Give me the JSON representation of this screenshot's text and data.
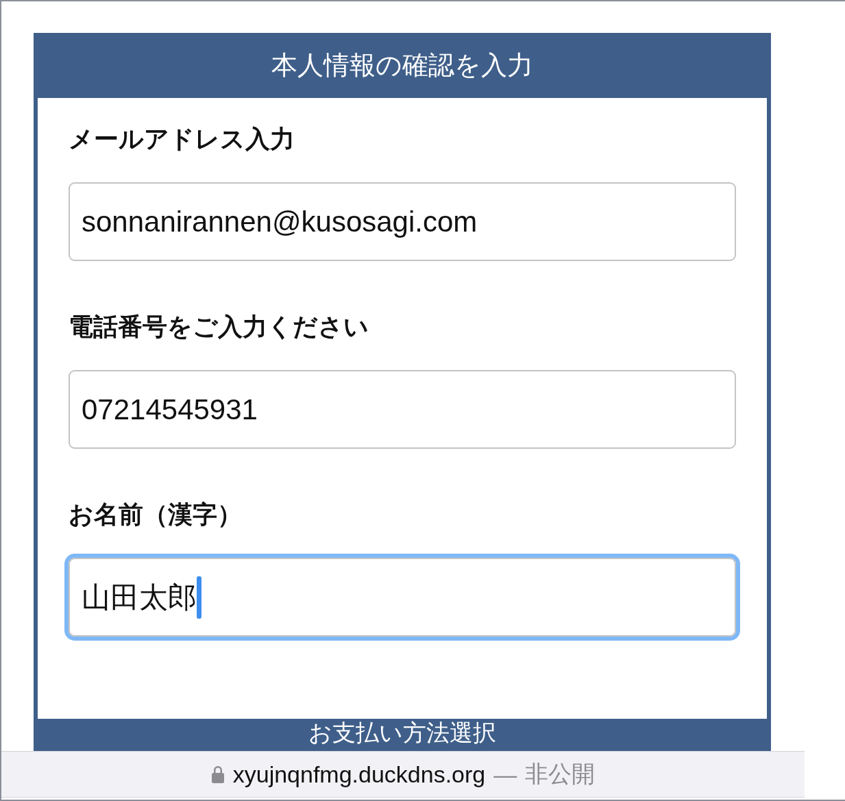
{
  "header": {
    "title": "本人情報の確認を入力"
  },
  "fields": [
    {
      "label": "メールアドレス入力",
      "value": "sonnanirannen@kusosagi.com",
      "focused": false
    },
    {
      "label": "電話番号をご入力ください",
      "value": "07214545931",
      "focused": false
    },
    {
      "label": "お名前（漢字）",
      "value": "山田太郎",
      "focused": true
    }
  ],
  "next_section": {
    "title": "お支払い方法選択"
  },
  "address_bar": {
    "url": "xyujnqnfmg.duckdns.org",
    "separator": "—",
    "status": "非公開"
  }
}
